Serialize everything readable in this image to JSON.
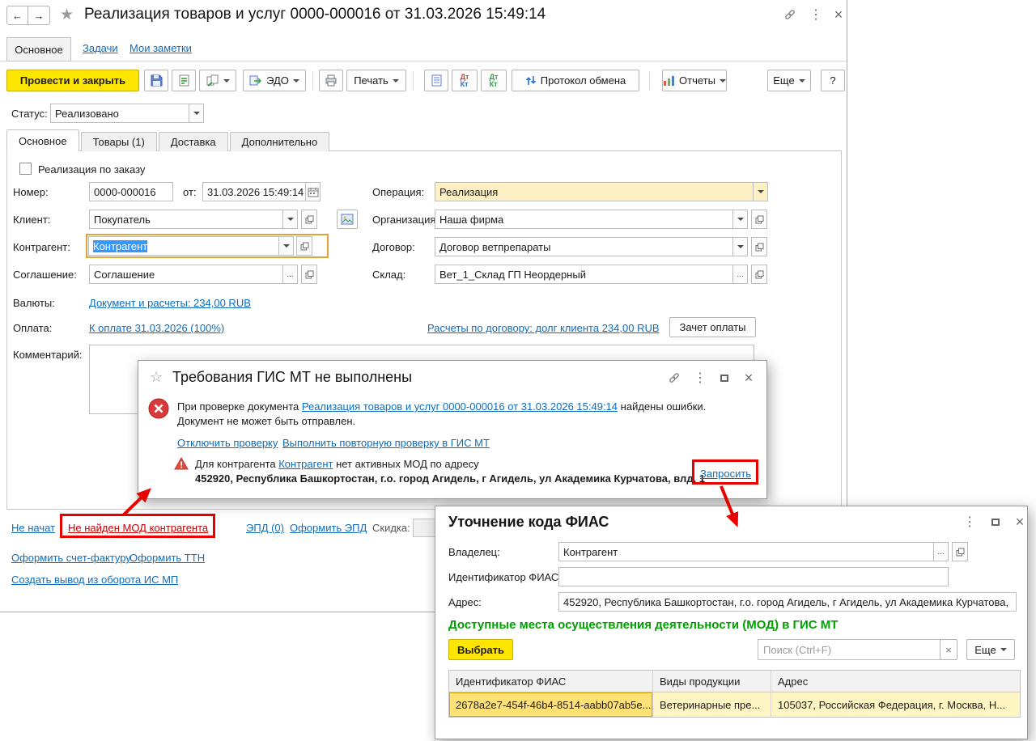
{
  "icons": {
    "back": "←",
    "forward": "→",
    "star": "★",
    "star_outline": "☆",
    "kebab": "⋮",
    "close": "×",
    "help": "?",
    "ellipsis": "...",
    "dt": "Дт",
    "kt": "Кт"
  },
  "main_window": {
    "title": "Реализация товаров и услуг 0000-000016 от 31.03.2026 15:49:14",
    "nav_tabs": [
      {
        "label": "Основное"
      },
      {
        "label": "Задачи"
      },
      {
        "label": "Мои заметки"
      }
    ],
    "toolbar": {
      "post_and_close": "Провести и закрыть",
      "edo": "ЭДО",
      "print_menu": "Печать",
      "exchange_protocol": "Протокол обмена",
      "reports": "Отчеты",
      "more": "Еще"
    },
    "status": {
      "label": "Статус:",
      "value": "Реализовано"
    },
    "doc_tabs": [
      {
        "label": "Основное"
      },
      {
        "label": "Товары (1)"
      },
      {
        "label": "Доставка"
      },
      {
        "label": "Дополнительно"
      }
    ],
    "form": {
      "by_order_checkbox": "Реализация по заказу",
      "number_label": "Номер:",
      "number_value": "0000-000016",
      "date_label": "от:",
      "date_value": "31.03.2026 15:49:14",
      "operation_label": "Операция:",
      "operation_value": "Реализация",
      "client_label": "Клиент:",
      "client_value": "Покупатель",
      "organization_label": "Организация:",
      "organization_value": "Наша фирма",
      "counterparty_label": "Контрагент:",
      "counterparty_value": "Контрагент",
      "contract_label": "Договор:",
      "contract_value": "Договор ветпрепараты",
      "agreement_label": "Соглашение:",
      "agreement_value": "Соглашение",
      "warehouse_label": "Склад:",
      "warehouse_value": "Вет_1_Склад ГП Неордерный",
      "currencies_label": "Валюты:",
      "currencies_link": "Документ и расчеты: 234,00 RUB",
      "payment_label": "Оплата:",
      "payment_due_link": "К оплате 31.03.2026 (100%)",
      "payment_settlements_link": "Расчеты по договору: долг клиента 234,00 RUB",
      "offset_button": "Зачет оплаты",
      "comment_label": "Комментарий:"
    },
    "footer": {
      "not_started_link": "Не начат",
      "mod_not_found_link": "Не найден МОД контрагента",
      "epd_link": "ЭПД (0)",
      "epd_create_link": "Оформить ЭПД",
      "discount_label": "Скидка:",
      "invoice_link": "Оформить счет-фактуру",
      "ttn_link": "Оформить ТТН",
      "withdrawal_link": "Создать вывод из оборота ИС МП"
    }
  },
  "gis_dialog": {
    "title": "Требования ГИС МТ не выполнены",
    "check_text_before": "При проверке документа",
    "check_doc_link": "Реализация товаров и услуг 0000-000016 от 31.03.2026 15:49:14",
    "check_text_after": "найдены ошибки.",
    "check_text_line2": "Документ не может быть отправлен.",
    "disable_check_link": "Отключить проверку",
    "recheck_link": "Выполнить повторную проверку в ГИС МТ",
    "warning_text_before": "Для контрагента",
    "warning_counterparty_link": "Контрагент",
    "warning_text_after": "нет активных МОД по адресу",
    "warning_address": "452920, Республика Башкортостан, г.о. город Агидель, г Агидель, ул Академика Курчатова, влд. 1",
    "request_link": "Запросить"
  },
  "fias_dialog": {
    "title": "Уточнение кода ФИАС",
    "owner_label": "Владелец:",
    "owner_value": "Контрагент",
    "fias_id_label": "Идентификатор ФИАС:",
    "fias_id_value": "",
    "address_label": "Адрес:",
    "address_value": "452920, Республика Башкортостан, г.о. город Агидель, г Агидель, ул Академика Курчатова,",
    "section_title": "Доступные места осуществления деятельности (МОД) в ГИС МТ",
    "select_button": "Выбрать",
    "search_placeholder": "Поиск (Ctrl+F)",
    "more_button": "Еще",
    "table": {
      "headers": [
        "Идентификатор ФИАС",
        "Виды продукции",
        "Адрес"
      ],
      "rows": [
        {
          "fias_id": "2678a2e7-454f-46b4-8514-aabb07ab5e...",
          "product_types": "Ветеринарные пре...",
          "address": "105037, Российская Федерация, г. Москва, Н..."
        }
      ]
    }
  }
}
